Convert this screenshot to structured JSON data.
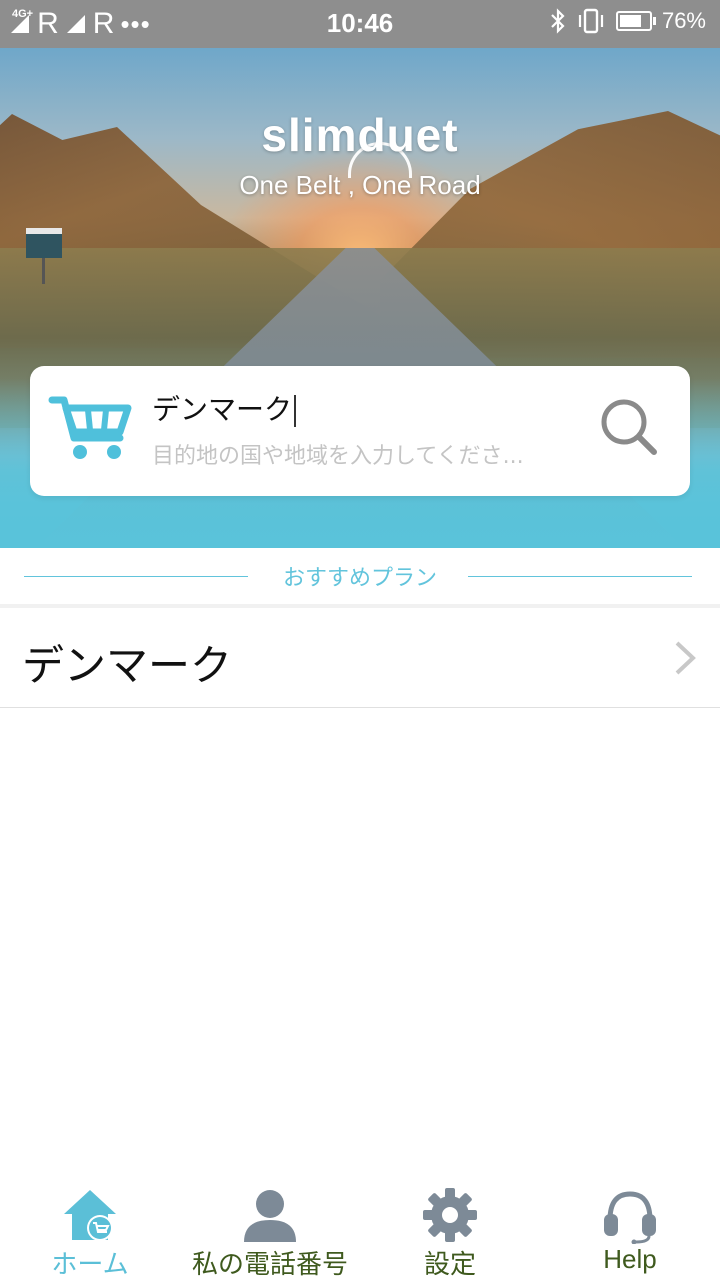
{
  "status_bar": {
    "network": "4G+",
    "roaming_1": "R",
    "roaming_2": "R",
    "dots": "•••",
    "time": "10:46",
    "battery": "76%",
    "battery_level": 0.76
  },
  "hero": {
    "logo": "slimduet",
    "slogan": "One Belt , One Road"
  },
  "search": {
    "value": "デンマーク",
    "placeholder": "目的地の国や地域を入力してくださ..."
  },
  "recommended": {
    "title": "おすすめプラン",
    "items": [
      {
        "label": "デンマーク"
      }
    ]
  },
  "tabs": [
    {
      "label": "ホーム",
      "icon": "home-cart-icon",
      "active": true
    },
    {
      "label": "私の電話番号",
      "icon": "person-icon",
      "active": false
    },
    {
      "label": "設定",
      "icon": "gear-icon",
      "active": false
    },
    {
      "label": "Help",
      "icon": "headset-icon",
      "active": false
    }
  ],
  "colors": {
    "accent": "#5ec6dc",
    "tab_active": "#5bbfd7",
    "tab_inactive_text": "#3f5a1e",
    "tab_inactive_icon": "#7d8a97",
    "status_bar_bg": "#8e8e8e"
  }
}
